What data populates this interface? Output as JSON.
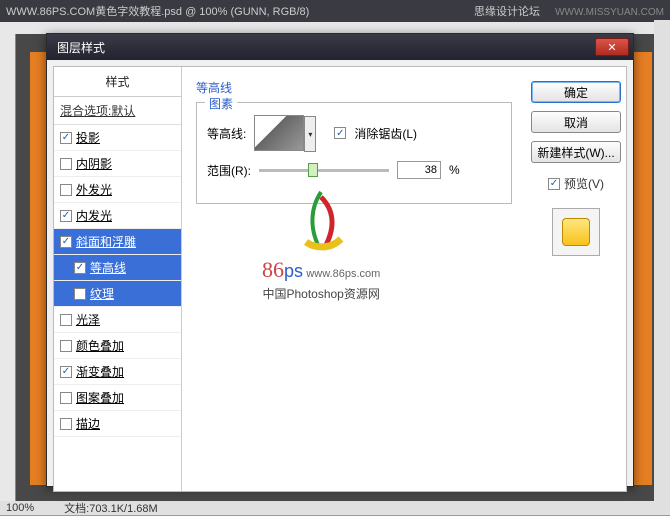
{
  "app": {
    "title": "WWW.86PS.COM黄色字效教程.psd @ 100% (GUNN, RGB/8)",
    "forum": "思缘设计论坛",
    "watermark": "WWW.MISSYUAN.COM"
  },
  "status": {
    "zoom": "100%",
    "doc": "文档:703.1K/1.68M"
  },
  "dialog": {
    "title": "图层样式",
    "stylesHeader": "样式",
    "blendRow": "混合选项:默认",
    "items": [
      {
        "label": "投影",
        "checked": true
      },
      {
        "label": "内阴影",
        "checked": false
      },
      {
        "label": "外发光",
        "checked": false
      },
      {
        "label": "内发光",
        "checked": true
      },
      {
        "label": "斜面和浮雕",
        "checked": true,
        "selected": true
      },
      {
        "label": "等高线",
        "checked": true,
        "sub": true,
        "selected": true
      },
      {
        "label": "纹理",
        "checked": false,
        "sub": true,
        "selected": true
      },
      {
        "label": "光泽",
        "checked": false
      },
      {
        "label": "颜色叠加",
        "checked": false
      },
      {
        "label": "渐变叠加",
        "checked": true
      },
      {
        "label": "图案叠加",
        "checked": false
      },
      {
        "label": "描边",
        "checked": false
      }
    ],
    "main": {
      "title": "等高线",
      "legend": "图素",
      "contourLabel": "等高线:",
      "antialias": "消除锯齿(L)",
      "rangeLabel": "范围(R):",
      "rangeValue": "38",
      "rangeUnit": "%"
    },
    "buttons": {
      "ok": "确定",
      "cancel": "取消",
      "newstyle": "新建样式(W)...",
      "preview": "预览(V)"
    }
  },
  "watermark_logo": {
    "brand": "86",
    "brand_suffix": "ps",
    "url": "www.86ps.com",
    "cn": "中国Photoshop资源网"
  }
}
